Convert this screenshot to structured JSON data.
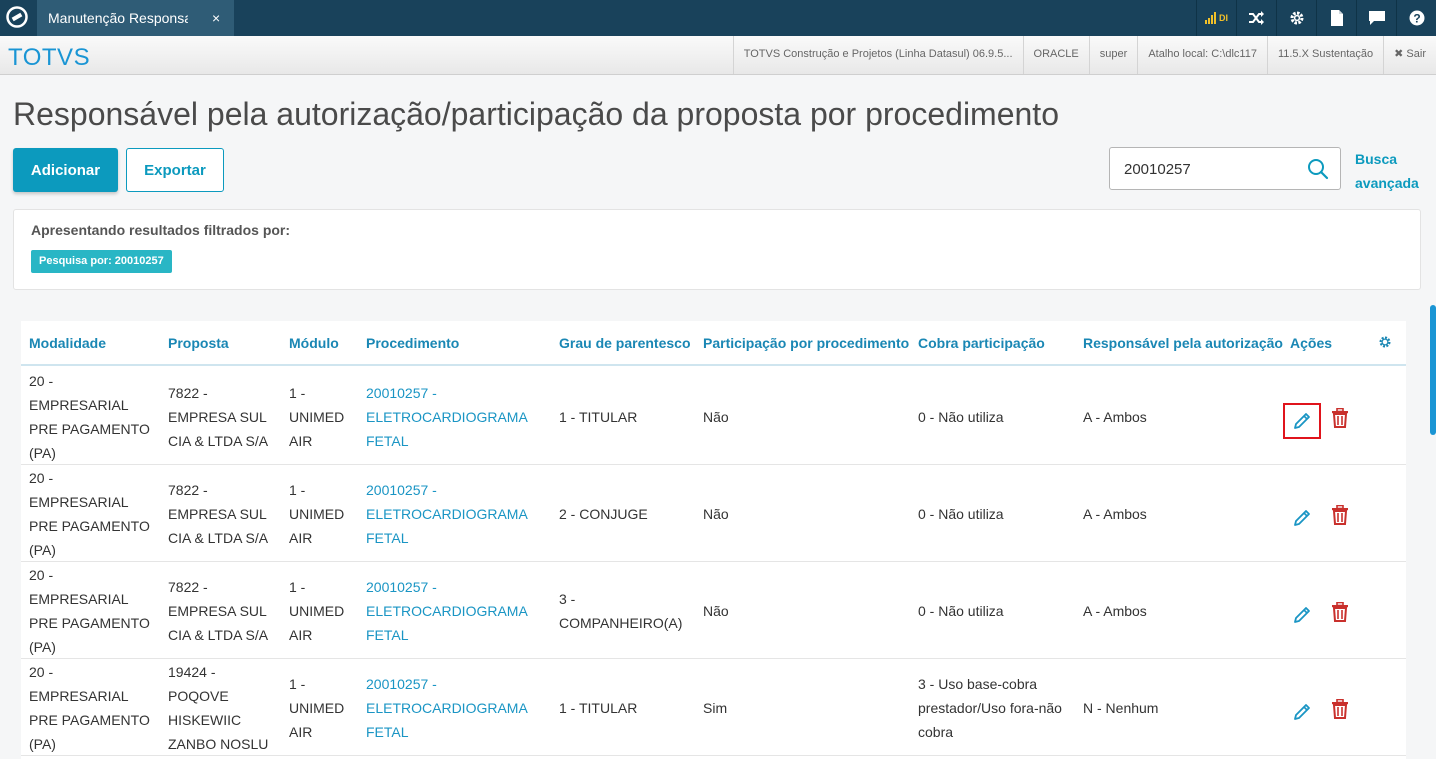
{
  "topbar": {
    "tab_label": "Manutenção Responsa",
    "tab_close": "×",
    "signal_label": "DI",
    "icons": [
      "signal-icon",
      "shuffle-icon",
      "gear-icon",
      "document-icon",
      "chat-icon",
      "help-icon"
    ]
  },
  "subbar": {
    "brand": "TOTVS",
    "items": [
      "TOTVS Construção e Projetos (Linha Datasul) 06.9.5...",
      "ORACLE",
      "super",
      "Atalho local: C:\\dlc117",
      "11.5.X Sustentação",
      "✖ Sair"
    ]
  },
  "page": {
    "title": "Responsável pela autorização/participação da proposta por procedimento",
    "add_label": "Adicionar",
    "export_label": "Exportar",
    "search_value": "20010257",
    "advanced_search_line1": "Busca",
    "advanced_search_line2": "avançada"
  },
  "filter": {
    "title": "Apresentando resultados filtrados por:",
    "chip": "Pesquisa por: 20010257"
  },
  "table": {
    "headers": [
      "Modalidade",
      "Proposta",
      "Módulo",
      "Procedimento",
      "Grau de parentesco",
      "Participação por procedimento",
      "Cobra participação",
      "Responsável pela autorização",
      "Ações"
    ],
    "rows": [
      {
        "modalidade": [
          "20 -",
          "EMPRESARIAL",
          "PRE PAGAMENTO",
          "(PA)"
        ],
        "proposta": [
          "7822 -",
          "EMPRESA SUL",
          "CIA & LTDA S/A"
        ],
        "modulo": [
          "1 -",
          "UNIMED",
          "AIR"
        ],
        "procedimento": [
          "20010257 -",
          "ELETROCARDIOGRAMA",
          "FETAL"
        ],
        "grau": [
          "1 - TITULAR"
        ],
        "participacao": "Não",
        "cobra": [
          "0 - Não utiliza"
        ],
        "responsavel": "A - Ambos"
      },
      {
        "modalidade": [
          "20 -",
          "EMPRESARIAL",
          "PRE PAGAMENTO",
          "(PA)"
        ],
        "proposta": [
          "7822 -",
          "EMPRESA SUL",
          "CIA & LTDA S/A"
        ],
        "modulo": [
          "1 -",
          "UNIMED",
          "AIR"
        ],
        "procedimento": [
          "20010257 -",
          "ELETROCARDIOGRAMA",
          "FETAL"
        ],
        "grau": [
          "2 - CONJUGE"
        ],
        "participacao": "Não",
        "cobra": [
          "0 - Não utiliza"
        ],
        "responsavel": "A - Ambos"
      },
      {
        "modalidade": [
          "20 -",
          "EMPRESARIAL",
          "PRE PAGAMENTO",
          "(PA)"
        ],
        "proposta": [
          "7822 -",
          "EMPRESA SUL",
          "CIA & LTDA S/A"
        ],
        "modulo": [
          "1 -",
          "UNIMED",
          "AIR"
        ],
        "procedimento": [
          "20010257 -",
          "ELETROCARDIOGRAMA",
          "FETAL"
        ],
        "grau": [
          "3 -",
          "COMPANHEIRO(A)"
        ],
        "participacao": "Não",
        "cobra": [
          "0 - Não utiliza"
        ],
        "responsavel": "A - Ambos"
      },
      {
        "modalidade": [
          "20 -",
          "EMPRESARIAL",
          "PRE PAGAMENTO",
          "(PA)"
        ],
        "proposta": [
          "19424 -",
          "POQOVE",
          "HISKEWIIC",
          "ZANBO NOSLU"
        ],
        "modulo": [
          "1 -",
          "UNIMED",
          "AIR"
        ],
        "procedimento": [
          "20010257 -",
          "ELETROCARDIOGRAMA",
          "FETAL"
        ],
        "grau": [
          "1 - TITULAR"
        ],
        "participacao": "Sim",
        "cobra": [
          "3 - Uso base-cobra",
          "prestador/Uso fora-não",
          "cobra"
        ],
        "responsavel": "N - Nenhum"
      }
    ]
  },
  "colors": {
    "topbar": "#19425b",
    "primary": "#0c9abe",
    "link": "#1a95c4",
    "delete": "#c9302c",
    "highlight": "#e0141c"
  }
}
